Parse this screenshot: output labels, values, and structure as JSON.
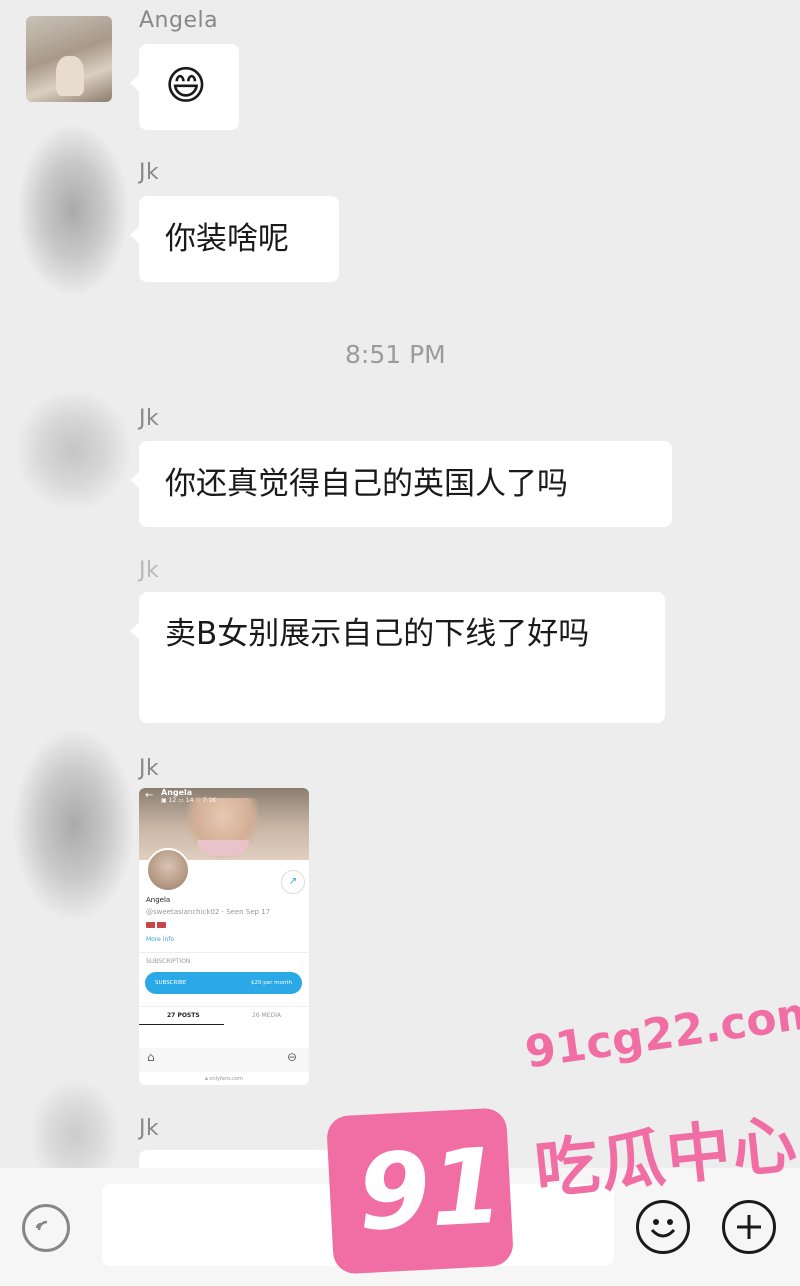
{
  "messages": [
    {
      "sender": "Angela",
      "text": "😄"
    },
    {
      "sender": "Jk",
      "text": "你装啥呢"
    },
    {
      "sender": "Jk",
      "text": "你还真觉得自己的英国人了吗"
    },
    {
      "sender": "Jk",
      "text": "卖B女别展示自己的下线了好吗"
    },
    {
      "sender": "Jk"
    },
    {
      "sender": "Jk"
    }
  ],
  "timestamp": "8:51 PM",
  "shared_screenshot": {
    "profile_name": "Angela",
    "stats": {
      "photos": "12",
      "videos": "14",
      "likes": "7.1K"
    },
    "username": "@sweetasianchick02",
    "seen": "Seen Sep 17",
    "more_info": "More info",
    "subscription_heading": "SUBSCRIPTION",
    "subscribe_label": "SUBSCRIBE",
    "price": "$20 per month",
    "tab_posts": "27 POSTS",
    "tab_media": "26 MEDIA",
    "url": "onlyfans.com"
  },
  "input": {
    "placeholder": ""
  },
  "watermark": {
    "domain": "91cg22.com",
    "logo": "91",
    "brand": "吃瓜中心",
    "color": "#f06ea3"
  }
}
